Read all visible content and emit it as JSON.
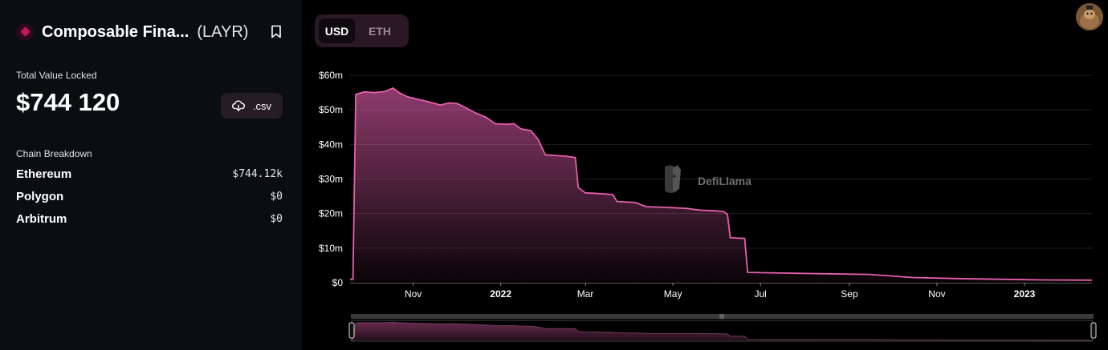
{
  "protocol": {
    "name": "Composable Fina...",
    "symbol": "(LAYR)"
  },
  "tvl": {
    "label": "Total Value Locked",
    "value": "$744 120",
    "csv_label": ".csv"
  },
  "breakdown": {
    "label": "Chain Breakdown",
    "chains": [
      {
        "name": "Ethereum",
        "value": "$744.12k"
      },
      {
        "name": "Polygon",
        "value": "$0"
      },
      {
        "name": "Arbitrum",
        "value": "$0"
      }
    ]
  },
  "currency_toggle": {
    "options": [
      "USD",
      "ETH"
    ],
    "selected": "USD"
  },
  "watermark": "DefiLlama",
  "colors": {
    "accent": "#e55fae",
    "panel_bg": "#0b0e11",
    "chart_bg": "#000000",
    "toggle_bg": "#2a1824"
  },
  "chart_data": {
    "type": "area",
    "title": "",
    "xlabel": "",
    "ylabel": "",
    "ylim": [
      0,
      60000000
    ],
    "xlim": [
      "2021-09-18",
      "2023-02-17"
    ],
    "yticks": [
      {
        "value": 0,
        "label": "$0"
      },
      {
        "value": 10000000,
        "label": "$10m"
      },
      {
        "value": 20000000,
        "label": "$20m"
      },
      {
        "value": 30000000,
        "label": "$30m"
      },
      {
        "value": 40000000,
        "label": "$40m"
      },
      {
        "value": 50000000,
        "label": "$50m"
      },
      {
        "value": 60000000,
        "label": "$60m"
      }
    ],
    "xticks": [
      {
        "date": "2021-11-01",
        "label": "Nov",
        "bold": false
      },
      {
        "date": "2022-01-01",
        "label": "2022",
        "bold": true
      },
      {
        "date": "2022-03-01",
        "label": "Mar",
        "bold": false
      },
      {
        "date": "2022-05-01",
        "label": "May",
        "bold": false
      },
      {
        "date": "2022-07-01",
        "label": "Jul",
        "bold": false
      },
      {
        "date": "2022-09-01",
        "label": "Sep",
        "bold": false
      },
      {
        "date": "2022-11-01",
        "label": "Nov",
        "bold": false
      },
      {
        "date": "2023-01-01",
        "label": "2023",
        "bold": true
      }
    ],
    "grid": true,
    "series": [
      {
        "color": "#e55fae",
        "points": [
          [
            "2021-09-18",
            1000000
          ],
          [
            "2021-09-20",
            1000000
          ],
          [
            "2021-09-22",
            54500000
          ],
          [
            "2021-09-28",
            55200000
          ],
          [
            "2021-10-05",
            55000000
          ],
          [
            "2021-10-12",
            55300000
          ],
          [
            "2021-10-18",
            56300000
          ],
          [
            "2021-10-22",
            55000000
          ],
          [
            "2021-10-28",
            53800000
          ],
          [
            "2021-11-05",
            53000000
          ],
          [
            "2021-11-12",
            52300000
          ],
          [
            "2021-11-20",
            51400000
          ],
          [
            "2021-11-26",
            52000000
          ],
          [
            "2021-12-02",
            51800000
          ],
          [
            "2021-12-08",
            50500000
          ],
          [
            "2021-12-15",
            49000000
          ],
          [
            "2021-12-22",
            47800000
          ],
          [
            "2021-12-28",
            46000000
          ],
          [
            "2022-01-05",
            45800000
          ],
          [
            "2022-01-10",
            46000000
          ],
          [
            "2022-01-15",
            44500000
          ],
          [
            "2022-01-22",
            44000000
          ],
          [
            "2022-01-27",
            41500000
          ],
          [
            "2022-02-01",
            37000000
          ],
          [
            "2022-02-08",
            36800000
          ],
          [
            "2022-02-15",
            36600000
          ],
          [
            "2022-02-22",
            36200000
          ],
          [
            "2022-02-24",
            27500000
          ],
          [
            "2022-03-01",
            26000000
          ],
          [
            "2022-03-10",
            25800000
          ],
          [
            "2022-03-20",
            25500000
          ],
          [
            "2022-03-23",
            23500000
          ],
          [
            "2022-04-05",
            23200000
          ],
          [
            "2022-04-12",
            22000000
          ],
          [
            "2022-04-25",
            21800000
          ],
          [
            "2022-05-01",
            21700000
          ],
          [
            "2022-05-10",
            21500000
          ],
          [
            "2022-05-20",
            21000000
          ],
          [
            "2022-05-30",
            20800000
          ],
          [
            "2022-06-05",
            20600000
          ],
          [
            "2022-06-08",
            19800000
          ],
          [
            "2022-06-10",
            13000000
          ],
          [
            "2022-06-20",
            12800000
          ],
          [
            "2022-06-22",
            3000000
          ],
          [
            "2022-07-15",
            2800000
          ],
          [
            "2022-08-15",
            2600000
          ],
          [
            "2022-09-15",
            2400000
          ],
          [
            "2022-10-15",
            1500000
          ],
          [
            "2022-11-15",
            1200000
          ],
          [
            "2022-12-15",
            1000000
          ],
          [
            "2023-01-15",
            800000
          ],
          [
            "2023-02-17",
            744120
          ]
        ]
      }
    ]
  }
}
